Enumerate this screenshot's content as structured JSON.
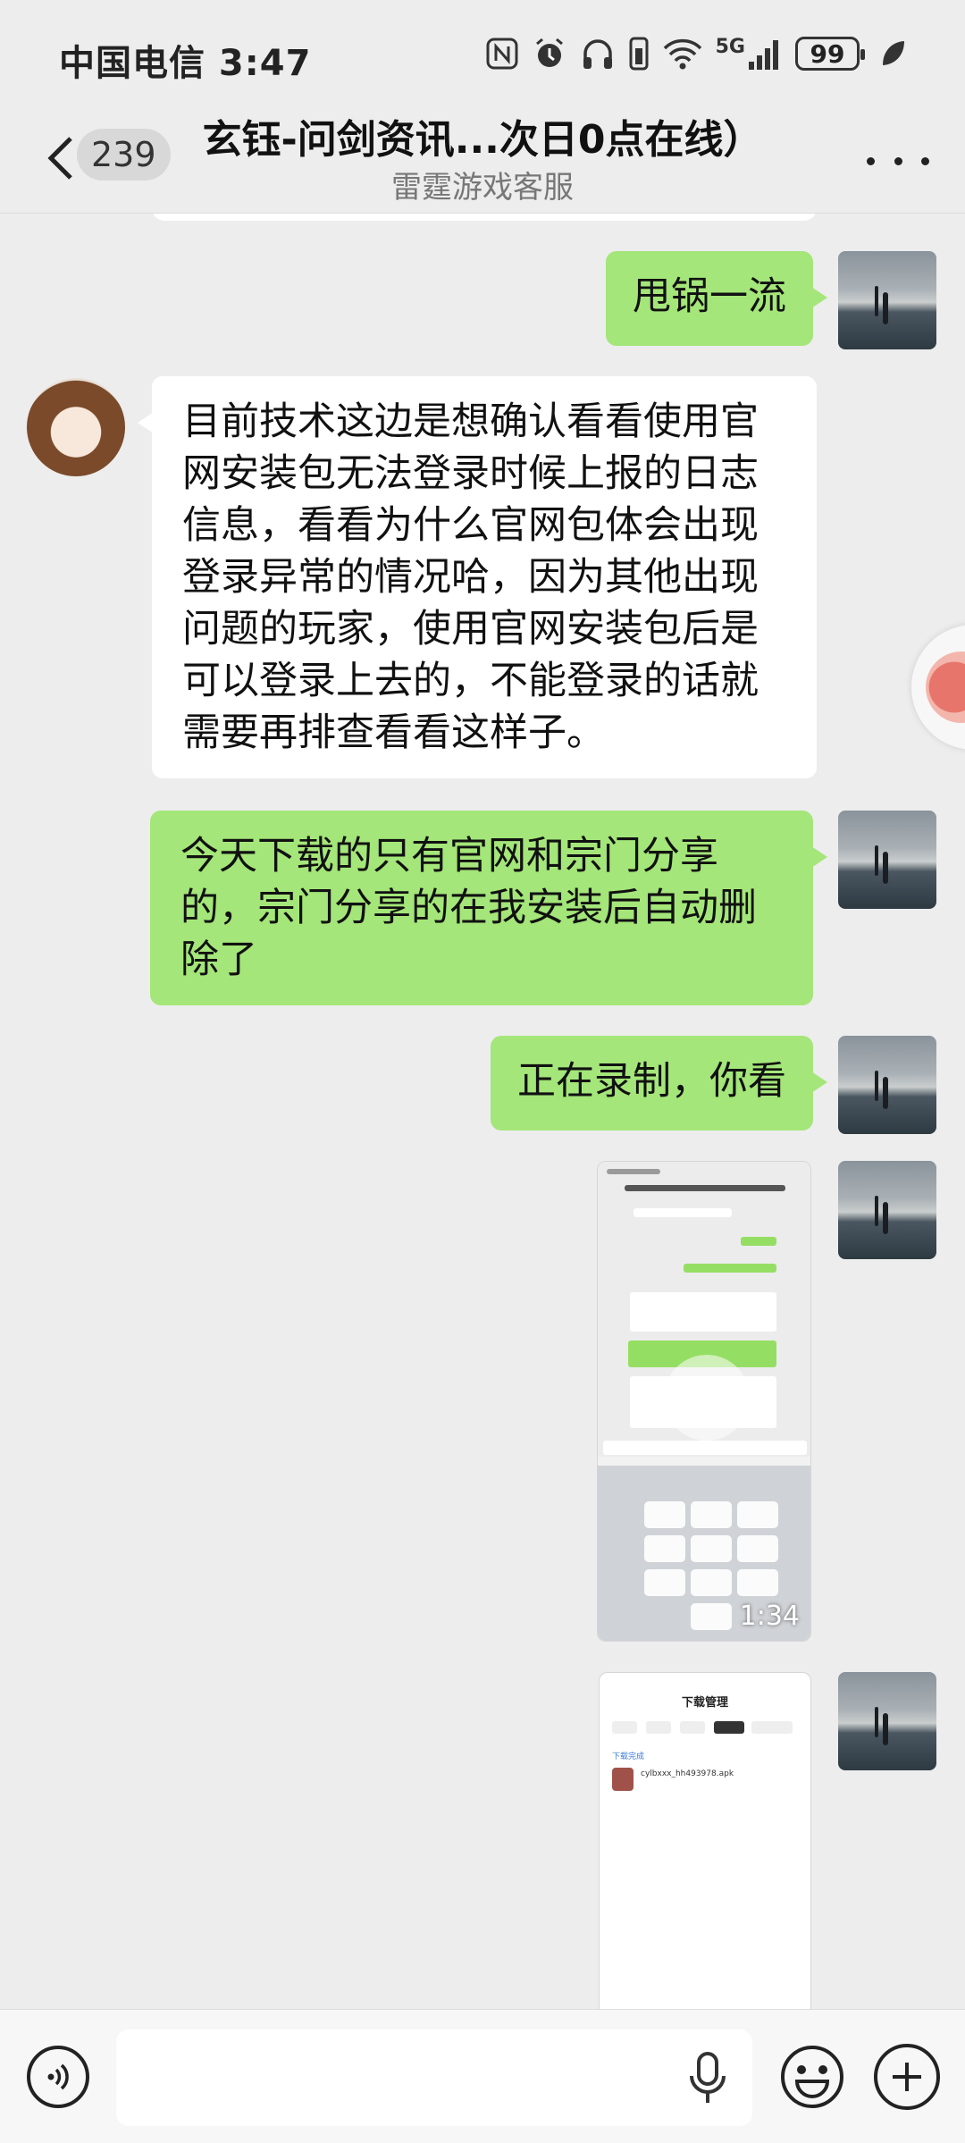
{
  "status_bar": {
    "carrier_time": "中国电信 3:47",
    "network": "5G",
    "battery": "99",
    "icons": [
      "nfc-icon",
      "alarm-icon",
      "headphones-icon",
      "vibrate-icon",
      "wifi-icon",
      "signal-icon",
      "battery-icon",
      "leaf-icon"
    ]
  },
  "header": {
    "unread_count": "239",
    "title": "玄钰-问剑资讯...次日0点在线）",
    "subtitle": "雷霆游戏客服"
  },
  "messages": [
    {
      "sender": "me",
      "type": "text",
      "text": "甩锅一流"
    },
    {
      "sender": "agent",
      "type": "text",
      "text": "目前技术这边是想确认看看使用官网安装包无法登录时候上报的日志信息，看看为什么官网包体会出现登录异常的情况哈，因为其他出现问题的玩家，使用官网安装包后是可以登录上去的，不能登录的话就需要再排查看看这样子。"
    },
    {
      "sender": "me",
      "type": "text",
      "text": "今天下载的只有官网和宗门分享的，宗门分享的在我安装后自动删除了"
    },
    {
      "sender": "me",
      "type": "text",
      "text": "正在录制，你看"
    },
    {
      "sender": "me",
      "type": "video",
      "duration": "1:34"
    },
    {
      "sender": "me",
      "type": "image",
      "title": "下载管理",
      "section_label": "下载完成",
      "file_name": "cylbxxx_hh493978.apk"
    }
  ],
  "input_bar": {
    "placeholder": "",
    "icons": [
      "voice-icon",
      "mic-icon",
      "emoji-icon",
      "plus-icon"
    ]
  }
}
